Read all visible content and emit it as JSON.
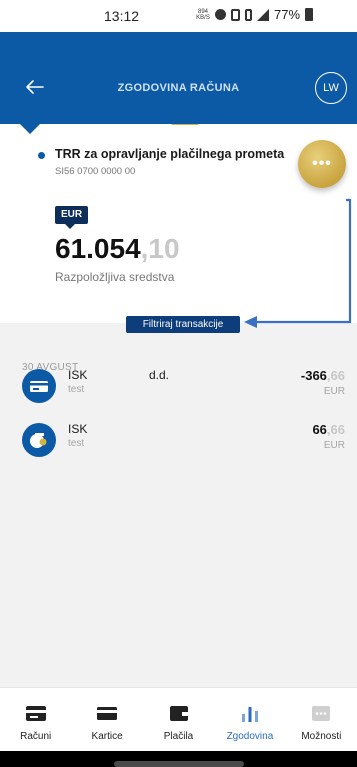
{
  "status_bar": {
    "time": "13:12",
    "mini_text": "894 KB/S",
    "battery": "77%"
  },
  "header": {
    "title": "ZGODOVINA RAČUNA",
    "avatar_initials": "LW"
  },
  "account": {
    "name": "TRR za opravljanje plačilnega prometa",
    "iban": "SI56 0700 0000 00",
    "more_label": "•••",
    "currency": "EUR",
    "balance_int": "61.054",
    "balance_dec": ",10",
    "available_label": "Razpoložljiva sredstva"
  },
  "filter_label": "Filtriraj transakcije",
  "date_group": "30 AVGUST",
  "transactions": [
    {
      "name": "ISK",
      "sub": "test",
      "middle": "d.d.",
      "amount_int": "-366",
      "amount_dec": ",66",
      "currency": "EUR",
      "icon": "card-payment-icon"
    },
    {
      "name": "ISK",
      "sub": "test",
      "middle": "",
      "amount_int": "66",
      "amount_dec": ",66",
      "currency": "EUR",
      "icon": "incoming-transfer-icon"
    }
  ],
  "nav": [
    {
      "label": "Računi",
      "icon": "wallet-card-icon",
      "active": false
    },
    {
      "label": "Kartice",
      "icon": "credit-card-icon",
      "active": false
    },
    {
      "label": "Plačila",
      "icon": "wallet-icon",
      "active": false
    },
    {
      "label": "Zgodovina",
      "icon": "bar-chart-icon",
      "active": true
    },
    {
      "label": "Možnosti",
      "icon": "more-options-icon",
      "active": false
    }
  ],
  "colors": {
    "primary": "#0c5aa6",
    "accent_gold": "#d4b343",
    "navy": "#0d2d5b",
    "annotation": "#3a6fc4"
  }
}
